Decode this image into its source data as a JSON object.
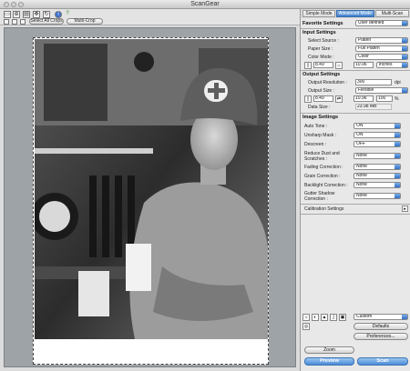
{
  "window": {
    "title": "ScanGear"
  },
  "toolbar": {
    "select_all_crops": "Select All Crops",
    "multi_crop": "Multi-Crop",
    "icons": [
      "marquee-icon",
      "zoom-icon",
      "scan-icon",
      "move-icon",
      "rotate-icon",
      "info-icon",
      "help-icon"
    ]
  },
  "mode_tabs": [
    {
      "label": "Simple Mode",
      "active": false
    },
    {
      "label": "Advanced Mode",
      "active": true
    },
    {
      "label": "Multi-Scan",
      "active": false
    }
  ],
  "favorite": {
    "label": "Favorite Settings",
    "value": "User defined"
  },
  "input_settings": {
    "heading": "Input Settings",
    "select_source": {
      "label": "Select Source :",
      "value": "Platen"
    },
    "paper_size": {
      "label": "Paper Size :",
      "value": "Full Platen"
    },
    "color_mode": {
      "label": "Color Mode :",
      "value": "Color"
    },
    "width": "8.49",
    "height": "10.96",
    "unit": "inches"
  },
  "output_settings": {
    "heading": "Output Settings",
    "resolution": {
      "label": "Output Resolution :",
      "value": "300",
      "unit": "dpi"
    },
    "output_size": {
      "label": "Output Size :",
      "value": "Flexible"
    },
    "width": "8.49",
    "height": "10.96",
    "scale": "100",
    "scale_unit": "%",
    "data_size": {
      "label": "Data Size :",
      "value": "23.98 MB"
    }
  },
  "image_settings": {
    "heading": "Image Settings",
    "rows": [
      {
        "label": "Auto Tone :",
        "value": "ON"
      },
      {
        "label": "Unsharp Mask :",
        "value": "ON"
      },
      {
        "label": "Descreen :",
        "value": "OFF"
      },
      {
        "label": "Reduce Dust and Scratches :",
        "value": "None"
      },
      {
        "label": "Fading Correction :",
        "value": "None"
      },
      {
        "label": "Grain Correction :",
        "value": "None"
      },
      {
        "label": "Backlight Correction :",
        "value": "None"
      },
      {
        "label": "Gutter Shadow Correction :",
        "value": "None"
      }
    ]
  },
  "calibration": {
    "label": "Calibration Settings"
  },
  "tone_bar": {
    "preset": "Custom",
    "defaults": "Defaults",
    "preferences": "Preferences..."
  },
  "bottom": {
    "zoom": "Zoom",
    "preview": "Preview",
    "scan": "Scan"
  }
}
